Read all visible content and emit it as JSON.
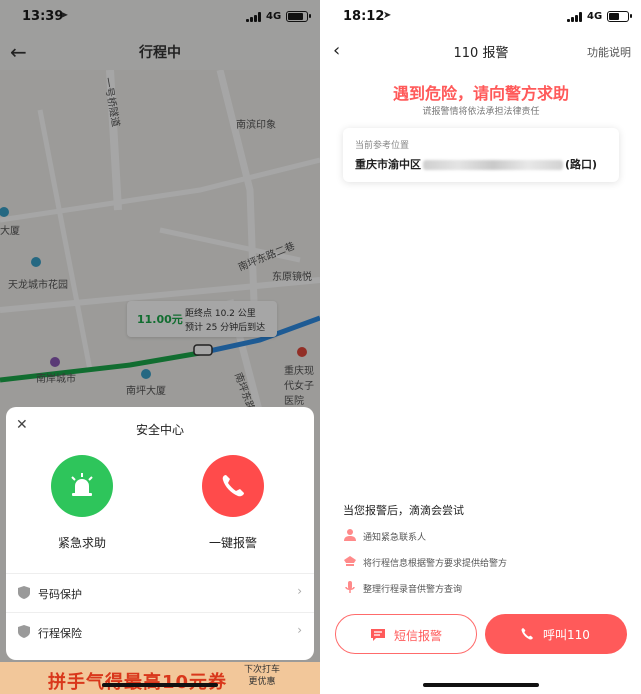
{
  "left": {
    "status": {
      "time": "13:39",
      "network": "4G"
    },
    "nav": {
      "title": "行程中"
    },
    "map_labels": {
      "road_vertical": "一号桥隧道",
      "place1": "南滨印象",
      "place2": "南坪东路二巷",
      "place3": "东原镜悦",
      "place4": "天龙城市花园",
      "place5": "南坪大厦",
      "place6": "南坪东路",
      "place7": "重庆现代女子医院",
      "place8": "大厦",
      "place9": "南岸城市"
    },
    "eta": {
      "price": "11.00元",
      "line1": "距终点 10.2 公里",
      "line2": "预计 25 分钟后到达"
    },
    "sheet": {
      "title": "安全中心",
      "emergency_label": "紧急求助",
      "police_label": "一键报警",
      "rows": [
        {
          "label": "号码保护"
        },
        {
          "label": "行程保险"
        }
      ]
    },
    "banner": {
      "promo": "拼手气得最高10元券",
      "next_line1": "下次打车",
      "next_line2": "更优惠"
    }
  },
  "right": {
    "status": {
      "time": "18:12",
      "network": "4G"
    },
    "nav": {
      "title": "110 报警",
      "help": "功能说明"
    },
    "headline": "遇到危险，请向警方求助",
    "subline": "谎报警情将依法承担法律责任",
    "location": {
      "caption": "当前参考位置",
      "prefix": "重庆市渝中区",
      "suffix": "(路口)"
    },
    "after_title": "当您报警后，滴滴会尝试",
    "steps": [
      {
        "label": "通知紧急联系人"
      },
      {
        "label": "将行程信息根据警方要求提供给警方"
      },
      {
        "label": "整理行程录音供警方查询"
      }
    ],
    "sms_label": "短信报警",
    "call_label": "呼叫110"
  },
  "colors": {
    "accent": "#ff5a5a",
    "green": "#2ec55b",
    "route": "#1ba84a",
    "route_blue": "#2f8de4"
  }
}
